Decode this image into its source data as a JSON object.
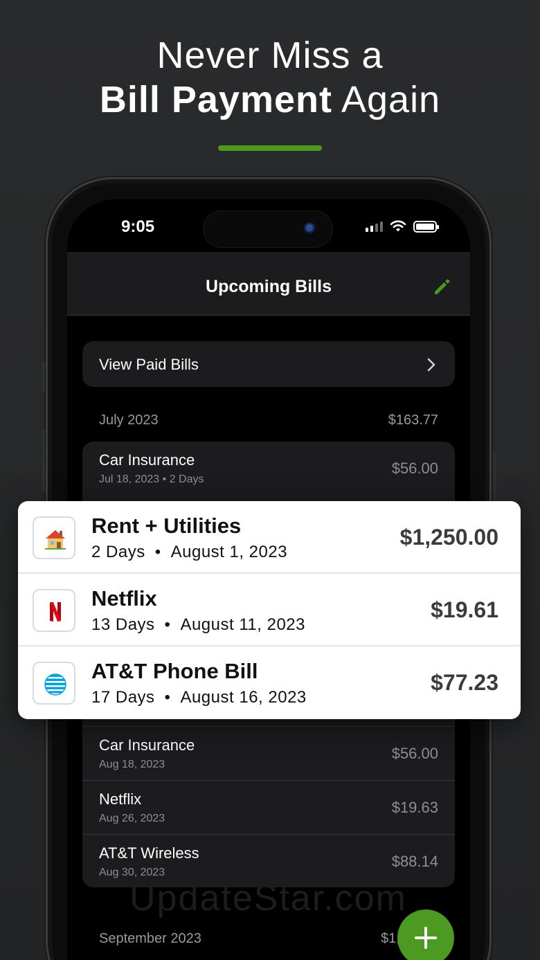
{
  "headline": {
    "line1": "Never Miss a",
    "bold": "Bill Payment",
    "rest": " Again"
  },
  "colors": {
    "accent": "#4c9a22",
    "background": "#2a2b2c"
  },
  "status_bar": {
    "time": "9:05"
  },
  "nav": {
    "title": "Upcoming Bills",
    "edit_icon": "pencil-icon"
  },
  "paid_bills": {
    "label": "View Paid Bills",
    "icon": "chevron-right-icon"
  },
  "sections": [
    {
      "month": "July 2023",
      "total": "$163.77",
      "bills": [
        {
          "name": "Car Insurance",
          "date": "Jul 18, 2023 • 2 Days",
          "amount": "$56.00"
        }
      ]
    },
    {
      "bills": [
        {
          "name": "Car Insurance",
          "date": "Aug 18, 2023",
          "amount": "$56.00"
        },
        {
          "name": "Netflix",
          "date": "Aug 26, 2023",
          "amount": "$19.63"
        },
        {
          "name": "AT&T Wireless",
          "date": "Aug 30, 2023",
          "amount": "$88.14"
        }
      ]
    },
    {
      "month": "September 2023",
      "total": "$1,4"
    }
  ],
  "promo_bills": [
    {
      "name": "Rent + Utilities",
      "days": "2 Days",
      "date": "August 1, 2023",
      "amount": "$1,250.00",
      "icon": "house-icon"
    },
    {
      "name": "Netflix",
      "days": "13 Days",
      "date": "August 11, 2023",
      "amount": "$19.61",
      "icon": "netflix-icon"
    },
    {
      "name": "AT&T Phone Bill",
      "days": "17 Days",
      "date": "August 16, 2023",
      "amount": "$77.23",
      "icon": "att-globe-icon"
    }
  ],
  "watermark": "UpdateStar.com",
  "fab": {
    "icon": "plus-icon"
  }
}
